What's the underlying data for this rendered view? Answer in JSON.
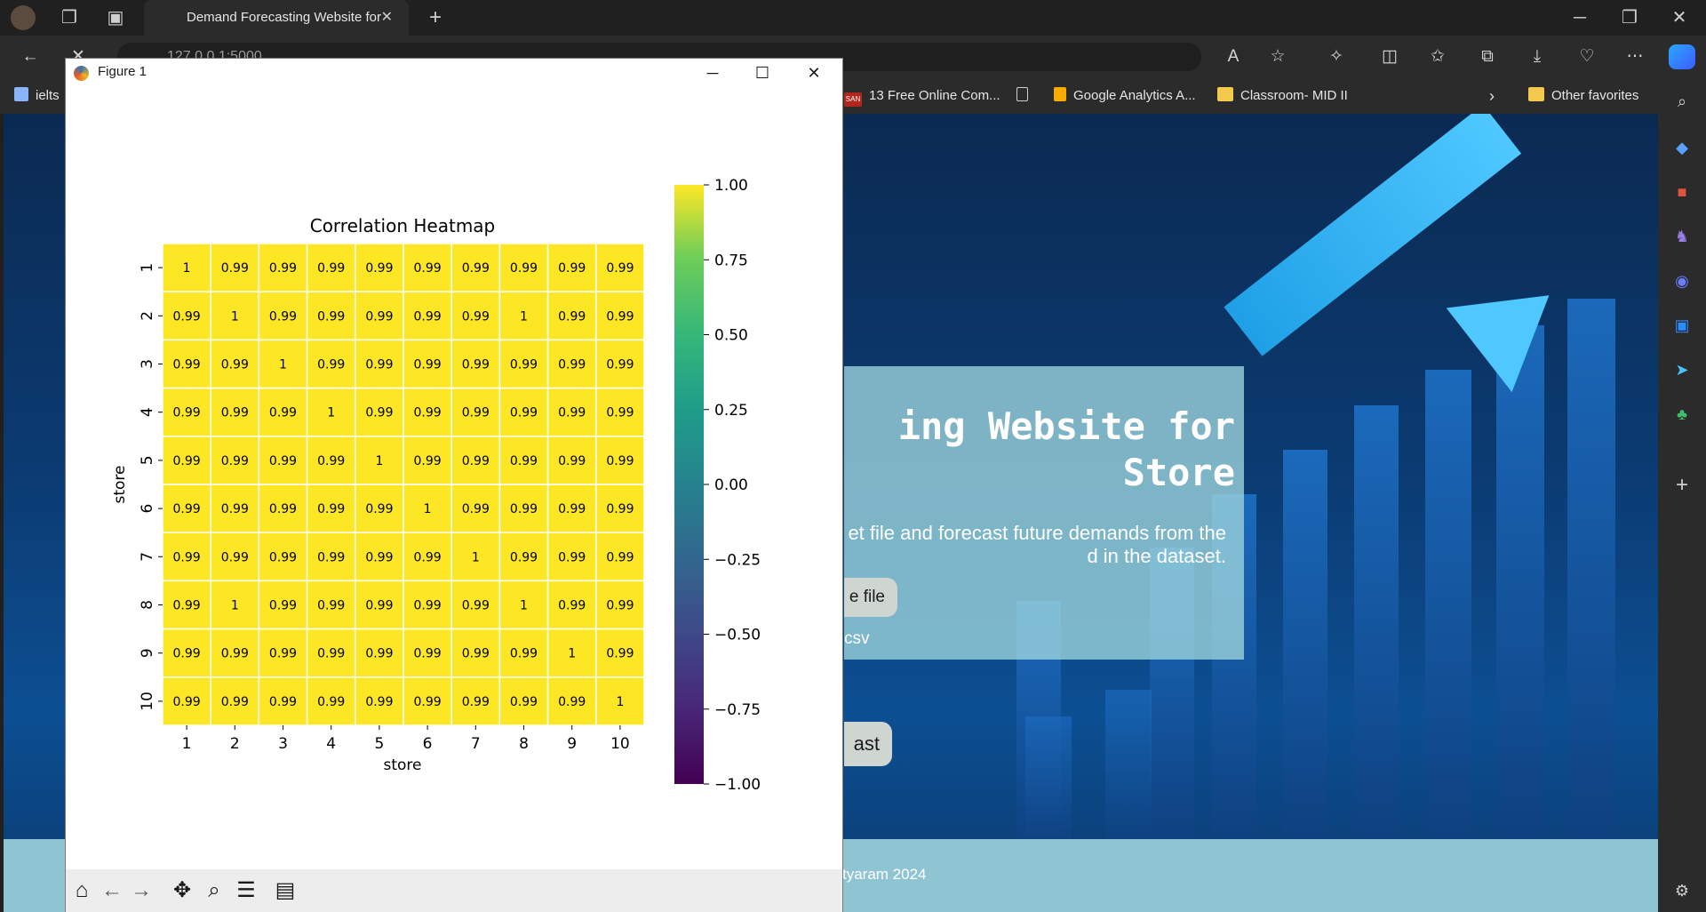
{
  "browser": {
    "tab_title": "Demand Forecasting Website for",
    "address": "127.0.0.1:5000",
    "favorites": [
      {
        "label": "ielts",
        "color": "#8ab4f8"
      },
      {
        "label": "13 Free Online Com...",
        "color": "#b3261e"
      },
      {
        "label": "",
        "color": "#cfcfcf"
      },
      {
        "label": "Google Analytics A...",
        "color": "#f9ab00"
      },
      {
        "label": "Classroom- MID II",
        "color": "#f2c94c"
      }
    ],
    "other_favorites": "Other favorites",
    "fav_ss_badge": "SAN"
  },
  "website": {
    "heading": "ing Website for\nStore",
    "subtitle": "et file and forecast future demands from the\nd in the dataset.",
    "choose_file": "e file",
    "file_name": "csv",
    "forecast_button": "ast",
    "footer": "tyaram 2024"
  },
  "figure": {
    "window_title": "Figure 1",
    "toolbar": [
      "home-icon",
      "back-icon",
      "forward-icon",
      "pan-icon",
      "zoom-icon",
      "configure-icon",
      "save-icon"
    ]
  },
  "chart_data": {
    "type": "heatmap",
    "title": "Correlation Heatmap",
    "xlabel": "store",
    "ylabel": "store",
    "x": [
      "1",
      "2",
      "3",
      "4",
      "5",
      "6",
      "7",
      "8",
      "9",
      "10"
    ],
    "y": [
      "1",
      "2",
      "3",
      "4",
      "5",
      "6",
      "7",
      "8",
      "9",
      "10"
    ],
    "values": [
      [
        "1",
        "0.99",
        "0.99",
        "0.99",
        "0.99",
        "0.99",
        "0.99",
        "0.99",
        "0.99",
        "0.99"
      ],
      [
        "0.99",
        "1",
        "0.99",
        "0.99",
        "0.99",
        "0.99",
        "0.99",
        "1",
        "0.99",
        "0.99"
      ],
      [
        "0.99",
        "0.99",
        "1",
        "0.99",
        "0.99",
        "0.99",
        "0.99",
        "0.99",
        "0.99",
        "0.99"
      ],
      [
        "0.99",
        "0.99",
        "0.99",
        "1",
        "0.99",
        "0.99",
        "0.99",
        "0.99",
        "0.99",
        "0.99"
      ],
      [
        "0.99",
        "0.99",
        "0.99",
        "0.99",
        "1",
        "0.99",
        "0.99",
        "0.99",
        "0.99",
        "0.99"
      ],
      [
        "0.99",
        "0.99",
        "0.99",
        "0.99",
        "0.99",
        "1",
        "0.99",
        "0.99",
        "0.99",
        "0.99"
      ],
      [
        "0.99",
        "0.99",
        "0.99",
        "0.99",
        "0.99",
        "0.99",
        "1",
        "0.99",
        "0.99",
        "0.99"
      ],
      [
        "0.99",
        "1",
        "0.99",
        "0.99",
        "0.99",
        "0.99",
        "0.99",
        "1",
        "0.99",
        "0.99"
      ],
      [
        "0.99",
        "0.99",
        "0.99",
        "0.99",
        "0.99",
        "0.99",
        "0.99",
        "0.99",
        "1",
        "0.99"
      ],
      [
        "0.99",
        "0.99",
        "0.99",
        "0.99",
        "0.99",
        "0.99",
        "0.99",
        "0.99",
        "0.99",
        "1"
      ]
    ],
    "colormap": "viridis",
    "cell_color": "#fde725",
    "colorbar": {
      "range": [
        -1.0,
        1.0
      ],
      "ticks": [
        "1.00",
        "0.75",
        "0.50",
        "0.25",
        "0.00",
        "−0.25",
        "−0.50",
        "−0.75",
        "−1.00"
      ],
      "tick_values": [
        1.0,
        0.75,
        0.5,
        0.25,
        0.0,
        -0.25,
        -0.5,
        -0.75,
        -1.0
      ]
    }
  }
}
